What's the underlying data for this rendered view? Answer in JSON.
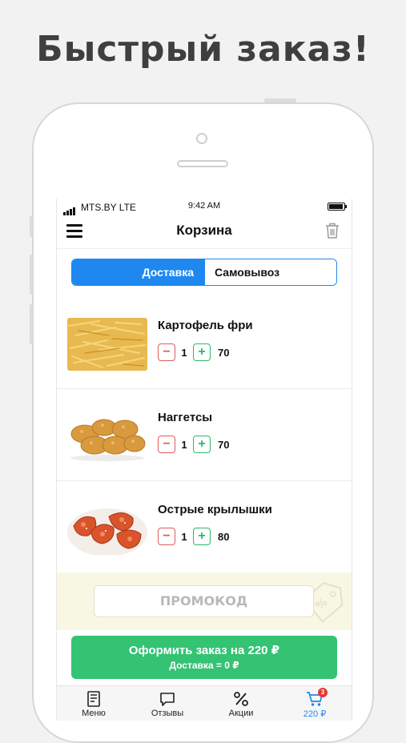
{
  "headline": "Быстрый заказ!",
  "status": {
    "carrier": "MTS.BY  LTE",
    "time": "9:42 AM"
  },
  "navbar": {
    "title": "Корзина",
    "menu_icon": "hamburger-icon",
    "trash_icon": "trash-icon"
  },
  "segment": {
    "delivery": "Доставка",
    "pickup": "Самовывоз",
    "selected": "delivery"
  },
  "items": [
    {
      "name": "Картофель фри",
      "qty": "1",
      "price": "70",
      "image": "fries-photo"
    },
    {
      "name": "Наггетсы",
      "qty": "1",
      "price": "70",
      "image": "nuggets-photo"
    },
    {
      "name": "Острые крылышки",
      "qty": "1",
      "price": "80",
      "image": "wings-photo"
    }
  ],
  "controls": {
    "minus": "−",
    "plus": "+"
  },
  "promo": {
    "placeholder": "ПРОМОКОД"
  },
  "checkout": {
    "label": "Оформить заказ на 220 ₽",
    "delivery": "Доставка = 0 ₽"
  },
  "tabbar": {
    "menu": "Меню",
    "reviews": "Отзывы",
    "promos": "Акции",
    "cart": "220 ₽",
    "cart_badge": "3"
  },
  "colors": {
    "accent": "#1e88f0",
    "green": "#34c273",
    "minus": "#e35a5a",
    "plus": "#2cb86a",
    "promo_bg": "#f7f7e4"
  }
}
